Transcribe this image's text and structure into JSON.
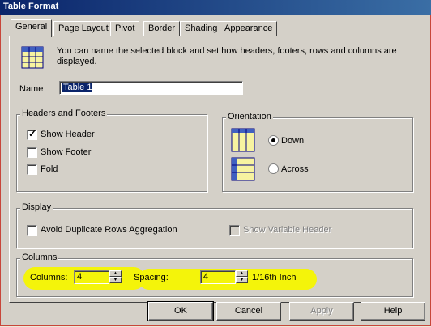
{
  "window": {
    "title": "Table Format"
  },
  "tabs": [
    {
      "label": "General",
      "active": true
    },
    {
      "label": "Page Layout"
    },
    {
      "label": "Pivot"
    },
    {
      "label": "Border"
    },
    {
      "label": "Shading"
    },
    {
      "label": "Appearance"
    }
  ],
  "general": {
    "description": "You can name the selected block and set how headers, footers, rows and columns are displayed.",
    "name_label": "Name",
    "name_value": "Table 1"
  },
  "headers_footers": {
    "title": "Headers and Footers",
    "show_header": {
      "label": "Show Header",
      "checked": true
    },
    "show_footer": {
      "label": "Show Footer",
      "checked": false
    },
    "fold": {
      "label": "Fold",
      "checked": false
    }
  },
  "orientation": {
    "title": "Orientation",
    "down": {
      "label": "Down",
      "selected": true
    },
    "across": {
      "label": "Across",
      "selected": false
    }
  },
  "display": {
    "title": "Display",
    "avoid_duplicate": {
      "label": "Avoid Duplicate Rows Aggregation",
      "checked": false
    },
    "show_variable_header": {
      "label": "Show Variable Header",
      "checked": false,
      "enabled": false
    }
  },
  "columns": {
    "title": "Columns",
    "columns_label": "Columns:",
    "columns_value": "4",
    "spacing_label": "Spacing:",
    "spacing_value": "4",
    "spacing_unit": "1/16th Inch"
  },
  "buttons": {
    "ok": "OK",
    "cancel": "Cancel",
    "apply": "Apply",
    "help": "Help"
  },
  "colors": {
    "highlight": "#f4f40a",
    "titlebar": "#0a246a"
  }
}
